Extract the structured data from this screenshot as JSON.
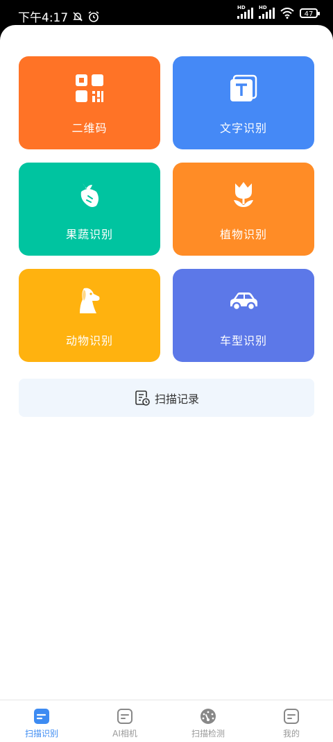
{
  "status": {
    "time": "下午4:17",
    "battery": "47",
    "signal1_label": "HD",
    "signal2_label": "HD"
  },
  "tiles": [
    {
      "label": "二维码",
      "color": "#ff7326",
      "icon": "qrcode-icon"
    },
    {
      "label": "文字识别",
      "color": "#4589f6",
      "icon": "text-icon"
    },
    {
      "label": "果蔬识别",
      "color": "#00c4a0",
      "icon": "carrot-icon"
    },
    {
      "label": "植物识别",
      "color": "#ff8c26",
      "icon": "tulip-icon"
    },
    {
      "label": "动物识别",
      "color": "#ffb20f",
      "icon": "dog-icon"
    },
    {
      "label": "车型识别",
      "color": "#5c78e8",
      "icon": "car-icon"
    }
  ],
  "history": {
    "label": "扫描记录",
    "icon": "document-clock-icon"
  },
  "nav": [
    {
      "label": "扫描识别",
      "active": true,
      "icon": "doc-icon"
    },
    {
      "label": "AI相机",
      "active": false,
      "icon": "doc-icon"
    },
    {
      "label": "扫描检测",
      "active": false,
      "icon": "gauge-icon"
    },
    {
      "label": "我的",
      "active": false,
      "icon": "doc-icon"
    }
  ],
  "colors": {
    "accent": "#3d8bf2",
    "history_bg": "#f0f6fd",
    "nav_inactive": "#999999"
  }
}
